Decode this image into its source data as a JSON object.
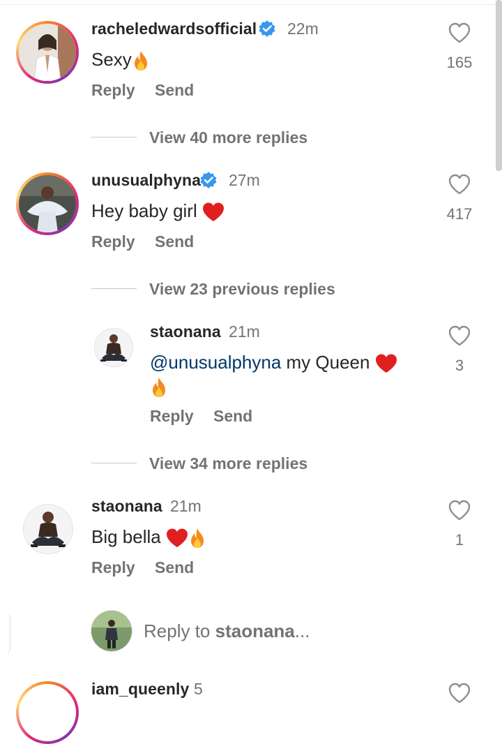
{
  "comments": [
    {
      "username": "racheledwardsofficial",
      "verified": true,
      "time": "22m",
      "text": "Sexy",
      "emojis": [
        "fire"
      ],
      "likes": "165"
    },
    {
      "username": "unusualphyna",
      "verified": true,
      "time": "27m",
      "text": "Hey baby girl",
      "emojis": [
        "heart"
      ],
      "likes": "417"
    },
    {
      "username": "staonana",
      "verified": false,
      "time": "21m",
      "mention": "@unusualphyna",
      "text": " my Queen",
      "emojis": [
        "heart",
        "fire"
      ],
      "likes": "3"
    },
    {
      "username": "staonana",
      "verified": false,
      "time": "21m",
      "text": "Big bella",
      "emojis": [
        "heart",
        "fire"
      ],
      "likes": "1"
    }
  ],
  "view_replies": [
    "View 40 more replies",
    "View 23 previous replies",
    "View 34 more replies"
  ],
  "actions": {
    "reply": "Reply",
    "send": "Send"
  },
  "reply_bar": {
    "prefix": "Reply to ",
    "username": "staonana",
    "suffix": "..."
  },
  "partial_next": {
    "username": "iam_queenly",
    "time": "5"
  },
  "colors": {
    "ring": "#dd2a7b",
    "verified": "#3897f0",
    "heart_emoji": "#e0201f",
    "mention": "#00376b"
  }
}
